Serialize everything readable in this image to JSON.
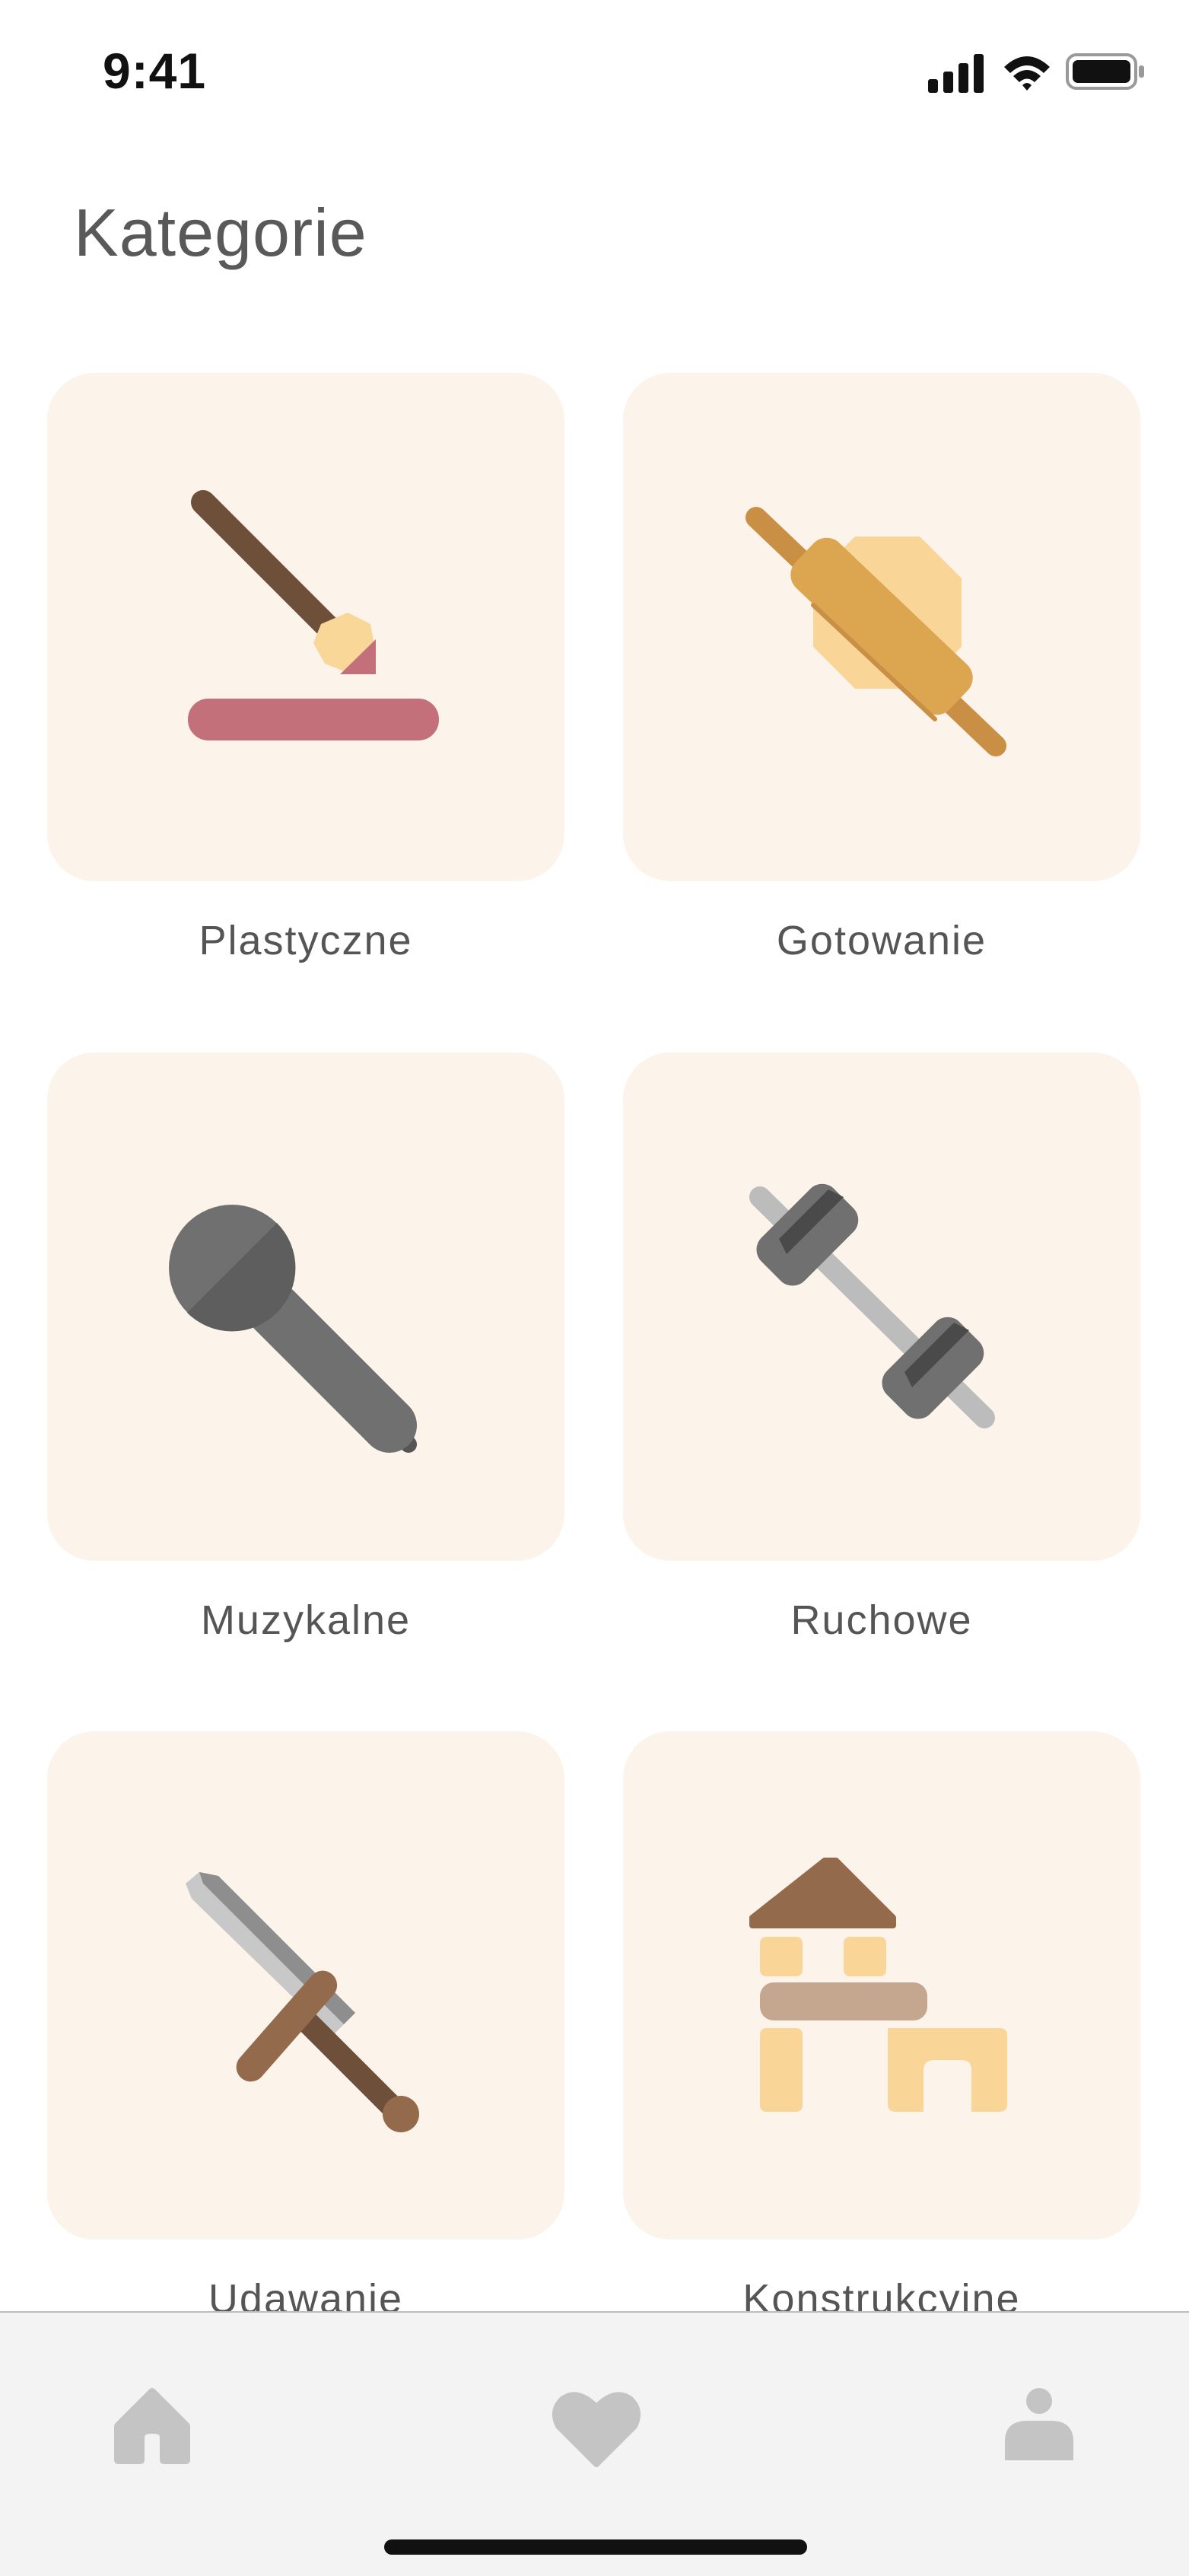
{
  "status_bar": {
    "time": "9:41",
    "icons": [
      "signal-icon",
      "wifi-icon",
      "battery-icon"
    ]
  },
  "page": {
    "title": "Kategorie"
  },
  "categories": [
    {
      "label": "Plastyczne",
      "icon": "paintbrush-icon"
    },
    {
      "label": "Gotowanie",
      "icon": "rolling-pin-icon"
    },
    {
      "label": "Muzykalne",
      "icon": "microphone-icon"
    },
    {
      "label": "Ruchowe",
      "icon": "dumbbell-icon"
    },
    {
      "label": "Udawanie",
      "icon": "sword-icon"
    },
    {
      "label": "Konstrukcyine",
      "icon": "blocks-icon"
    }
  ],
  "tab_bar": {
    "items": [
      {
        "name": "home",
        "icon": "home-icon"
      },
      {
        "name": "favorites",
        "icon": "heart-icon"
      },
      {
        "name": "profile",
        "icon": "person-icon"
      }
    ]
  },
  "colors": {
    "card_background": "#fcf3ea",
    "tab_bar_background": "#f3f3f3",
    "tab_icon": "#c4c4c4",
    "text": "#555555"
  }
}
